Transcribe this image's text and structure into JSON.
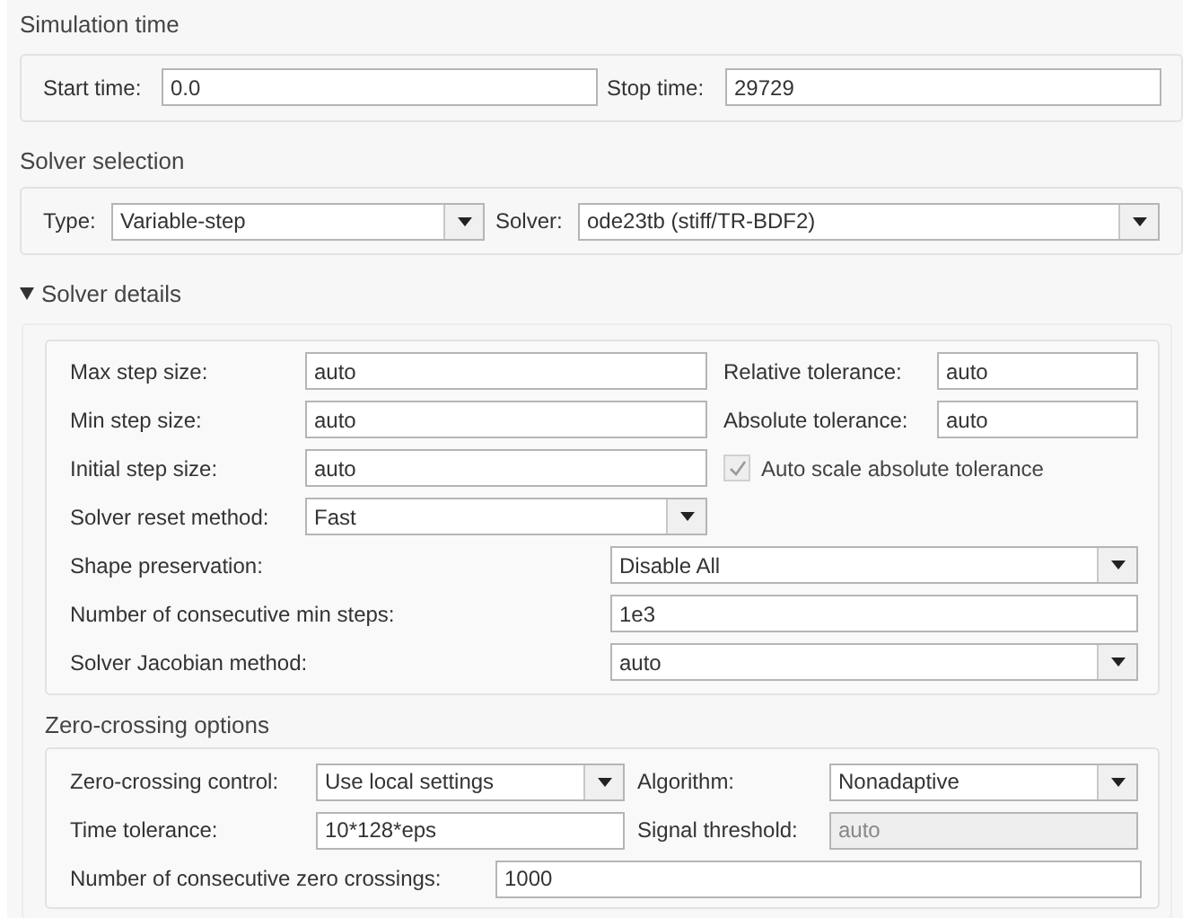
{
  "simulation_time": {
    "title": "Simulation time",
    "fields": [
      {
        "label": "Start time:",
        "value": "0.0",
        "kind": "text"
      },
      {
        "label": "Stop time:",
        "value": "29729",
        "kind": "text"
      }
    ]
  },
  "solver_selection": {
    "title": "Solver selection",
    "fields": [
      {
        "label": "Type:",
        "value": "Variable-step",
        "kind": "dropdown"
      },
      {
        "label": "Solver:",
        "value": "ode23tb (stiff/TR-BDF2)",
        "kind": "dropdown"
      }
    ]
  },
  "solver_details": {
    "title": "Solver details",
    "expanded": true,
    "rows": [
      [
        {
          "label": "Max step size:",
          "value": "auto",
          "kind": "text"
        },
        {
          "label": "Relative tolerance:",
          "value": "auto",
          "kind": "text"
        }
      ],
      [
        {
          "label": "Min step size:",
          "value": "auto",
          "kind": "text"
        },
        {
          "label": "Absolute tolerance:",
          "value": "auto",
          "kind": "text"
        }
      ],
      [
        {
          "label": "Initial step size:",
          "value": "auto",
          "kind": "text"
        },
        {
          "label": "Auto scale absolute tolerance",
          "kind": "checkbox",
          "checked": true,
          "disabled": true
        }
      ],
      [
        {
          "label": "Solver reset method:",
          "value": "Fast",
          "kind": "dropdown"
        }
      ]
    ],
    "wide_rows": [
      {
        "label": "Shape preservation:",
        "value": "Disable All",
        "kind": "dropdown"
      },
      {
        "label": "Number of consecutive min steps:",
        "value": "1e3",
        "kind": "text"
      },
      {
        "label": "Solver Jacobian method:",
        "value": "auto",
        "kind": "dropdown"
      }
    ]
  },
  "zero_crossing": {
    "title": "Zero-crossing options",
    "rows": [
      [
        {
          "label": "Zero-crossing control:",
          "value": "Use local settings",
          "kind": "dropdown",
          "disabled": false
        },
        {
          "label": "Algorithm:",
          "value": "Nonadaptive",
          "kind": "dropdown",
          "disabled": false
        }
      ],
      [
        {
          "label": "Time tolerance:",
          "value": "10*128*eps",
          "kind": "text",
          "disabled": false
        },
        {
          "label": "Signal threshold:",
          "value": "auto",
          "kind": "text",
          "disabled": true
        }
      ]
    ],
    "last_row": {
      "label": "Number of consecutive zero crossings:",
      "value": "1000",
      "kind": "text"
    }
  }
}
